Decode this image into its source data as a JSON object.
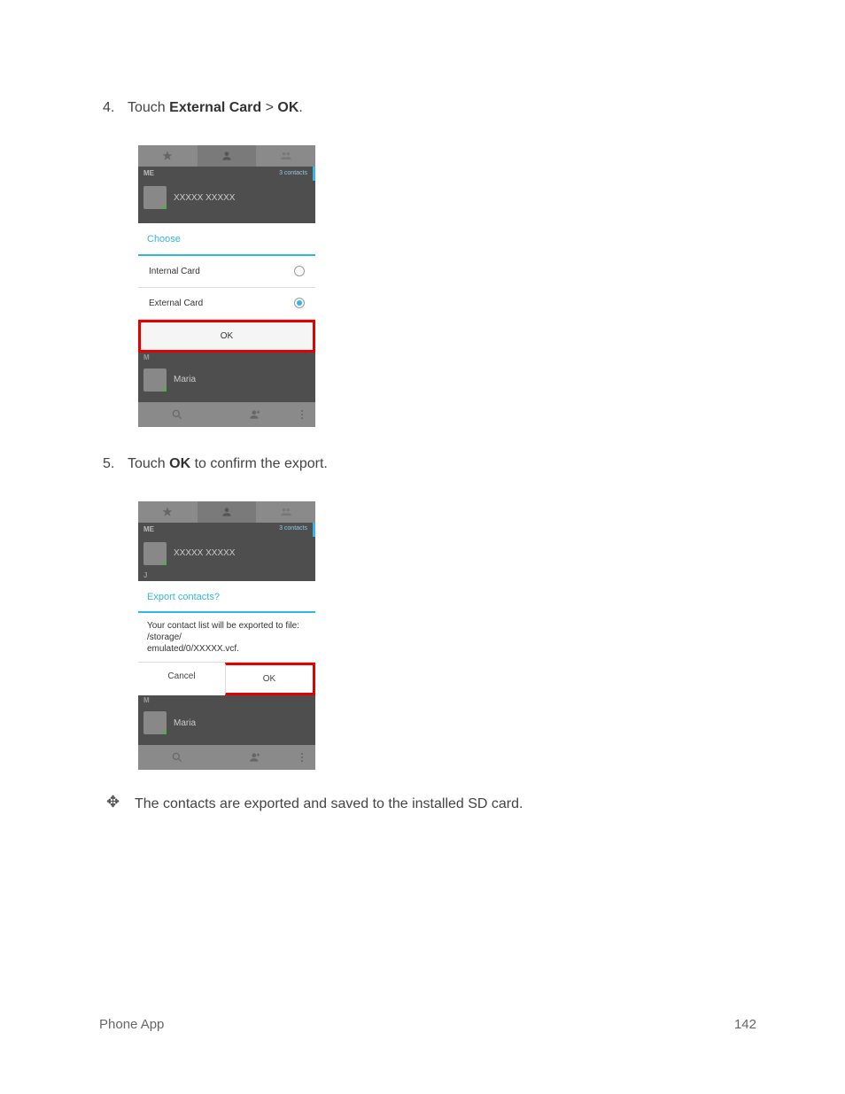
{
  "step4": {
    "num": "4.",
    "pre": "Touch ",
    "b1": "External Card",
    "mid": " > ",
    "b2": "OK",
    "post": "."
  },
  "step5": {
    "num": "5.",
    "pre": "Touch ",
    "b1": "OK",
    "post": " to confirm the export."
  },
  "result": "The contacts are exported and saved to the installed SD card.",
  "phone_common": {
    "me": "ME",
    "contacts_count": "3 contacts",
    "sample_contact": "XXXXX XXXXX",
    "maria": "Maria",
    "letter_m": "M",
    "letter_j": "J"
  },
  "dialog1": {
    "title": "Choose",
    "opt1": "Internal Card",
    "opt2": "External Card",
    "ok": "OK"
  },
  "dialog2": {
    "title": "Export contacts?",
    "msg": "Your contact list will be exported to file: /storage/\nemulated/0/XXXXX.vcf.",
    "cancel": "Cancel",
    "ok": "OK"
  },
  "footer": {
    "left": "Phone App",
    "right": "142"
  }
}
